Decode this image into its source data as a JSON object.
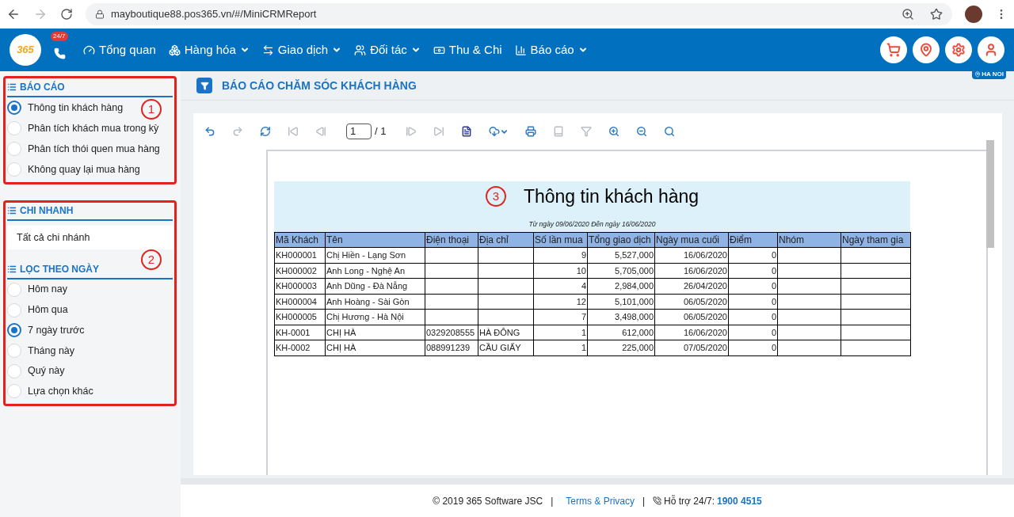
{
  "browser": {
    "url": "mayboutique88.pos365.vn/#/MiniCRMReport"
  },
  "nav": {
    "logo": "365",
    "hotline_badge": "24/7",
    "items": [
      {
        "kind": "dashboard",
        "label": "Tổng quan",
        "dropdown": false
      },
      {
        "kind": "boxes",
        "label": "Hàng hóa",
        "dropdown": true
      },
      {
        "kind": "exchange",
        "label": "Giao dịch",
        "dropdown": true
      },
      {
        "kind": "users",
        "label": "Đối tác",
        "dropdown": true
      },
      {
        "kind": "money",
        "label": "Thu & Chi",
        "dropdown": false
      },
      {
        "kind": "chart",
        "label": "Báo cáo",
        "dropdown": true
      }
    ],
    "branch_badge": "HA NOI"
  },
  "sidebar": {
    "report_section": {
      "title": "BÁO CÁO",
      "annotation": "1",
      "options": [
        {
          "label": "Thông tin khách hàng",
          "selected": true
        },
        {
          "label": "Phân tích khách mua trong kỳ",
          "selected": false
        },
        {
          "label": "Phân tích thói quen mua hàng",
          "selected": false
        },
        {
          "label": "Không quay lại mua hàng",
          "selected": false
        }
      ]
    },
    "branch_section": {
      "title": "CHI NHANH",
      "value": "Tất cả chi nhánh",
      "annotation": "2"
    },
    "date_section": {
      "title": "LỌC THEO NGÀY",
      "options": [
        {
          "label": "Hôm nay",
          "selected": false
        },
        {
          "label": "Hôm qua",
          "selected": false
        },
        {
          "label": "7 ngày trước",
          "selected": true
        },
        {
          "label": "Tháng này",
          "selected": false
        },
        {
          "label": "Quý này",
          "selected": false
        },
        {
          "label": "Lựa chọn khác",
          "selected": false
        }
      ]
    }
  },
  "page_title": "BÁO CÁO CHĂM SÓC KHÁCH HÀNG",
  "toolbar": {
    "tools": [
      {
        "kind": "undo",
        "disabled": false
      },
      {
        "kind": "redo",
        "disabled": true
      },
      {
        "kind": "refresh",
        "disabled": false
      },
      {
        "kind": "first",
        "disabled": true
      },
      {
        "kind": "prev",
        "disabled": true
      },
      {
        "kind": "page"
      },
      {
        "kind": "next",
        "disabled": true
      },
      {
        "kind": "last",
        "disabled": true
      },
      {
        "kind": "document",
        "disabled": false
      },
      {
        "kind": "export",
        "disabled": false
      },
      {
        "kind": "print",
        "disabled": false
      },
      {
        "kind": "book",
        "disabled": true
      },
      {
        "kind": "filter",
        "disabled": true
      },
      {
        "kind": "zoom_in",
        "disabled": false
      },
      {
        "kind": "zoom_out",
        "disabled": false
      },
      {
        "kind": "search",
        "disabled": false
      }
    ],
    "page_value": "1",
    "page_total": "/ 1"
  },
  "report": {
    "annotation": "3",
    "title": "Thông tin khách hàng",
    "subtitle": "Từ ngày 09/06/2020 Đến ngày 16/06/2020",
    "columns": [
      "Mã Khách",
      "Tên",
      "Điện thoại",
      "Địa chỉ",
      "Số lần mua",
      "Tổng giao dịch",
      "Ngày mua cuối",
      "Điểm",
      "Nhóm",
      "Ngày tham gia"
    ],
    "rows": [
      [
        "KH000001",
        "Chị Hiền - Lạng Sơn",
        "",
        "",
        "9",
        "5,527,000",
        "16/06/2020",
        "0",
        "",
        ""
      ],
      [
        "KH000002",
        "Anh Long - Nghệ An",
        "",
        "",
        "10",
        "5,705,000",
        "16/06/2020",
        "0",
        "",
        ""
      ],
      [
        "KH000003",
        "Anh Dũng - Đà Nẵng",
        "",
        "",
        "4",
        "2,984,000",
        "26/04/2020",
        "0",
        "",
        ""
      ],
      [
        "KH000004",
        "Anh Hoàng - Sài Gòn",
        "",
        "",
        "12",
        "5,101,000",
        "06/05/2020",
        "0",
        "",
        ""
      ],
      [
        "KH000005",
        "Chị Hương - Hà Nội",
        "",
        "",
        "7",
        "3,498,000",
        "06/05/2020",
        "0",
        "",
        ""
      ],
      [
        "KH-0001",
        "CHỊ HÀ",
        "0329208555",
        "HÀ ĐÔNG",
        "1",
        "612,000",
        "16/06/2020",
        "0",
        "",
        ""
      ],
      [
        "KH-0002",
        "CHỊ HÀ",
        "088991239",
        "CẦU GIẤY",
        "1",
        "225,000",
        "07/05/2020",
        "0",
        "",
        ""
      ]
    ]
  },
  "footer": {
    "copyright": "© 2019 365 Software JSC",
    "separator_1": "|",
    "terms": "Terms & Privacy",
    "separator_2": "|",
    "support_label": "Hỗ trợ 24/7:",
    "support_phone": "1900 4515"
  }
}
